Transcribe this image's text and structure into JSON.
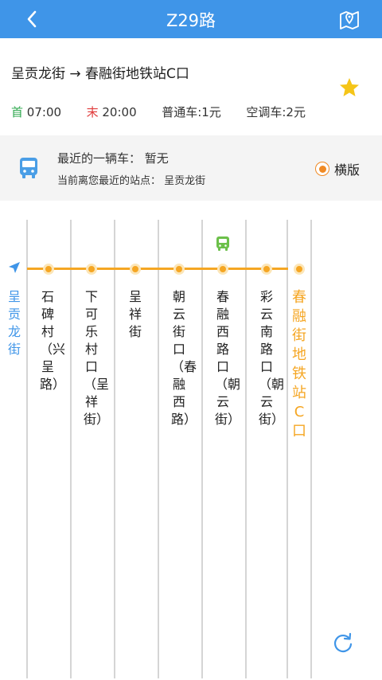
{
  "header": {
    "title": "Z29路"
  },
  "route": {
    "name": "呈贡龙街 → 春融街地铁站C口"
  },
  "schedule": {
    "first_mark": "首",
    "first_time": "07:00",
    "last_mark": "末",
    "last_time": "20:00",
    "normal_fare": "普通车:1元",
    "ac_fare": "空调车:2元"
  },
  "info": {
    "nearest_bus": "最近的一辆车：  暂无",
    "nearest_stop": "当前离您最近的站点：  呈贡龙街",
    "landscape_label": "横版"
  },
  "stops": [
    "呈贡龙街",
    "石碑村（兴呈路）",
    "下可乐村口（呈祥街）",
    "呈祥街",
    "朝云街口（春融西路）",
    "春融西路口（朝云街）",
    "彩云南路口（朝云街）",
    "春融街地铁站C口"
  ],
  "colors": {
    "accent": "#3f95e8",
    "line": "#f5a623",
    "bus": "#6cc04a"
  },
  "icons": [
    "back-icon",
    "map-pin-icon",
    "star-icon",
    "bus-icon",
    "location-arrow-icon",
    "refresh-icon"
  ]
}
